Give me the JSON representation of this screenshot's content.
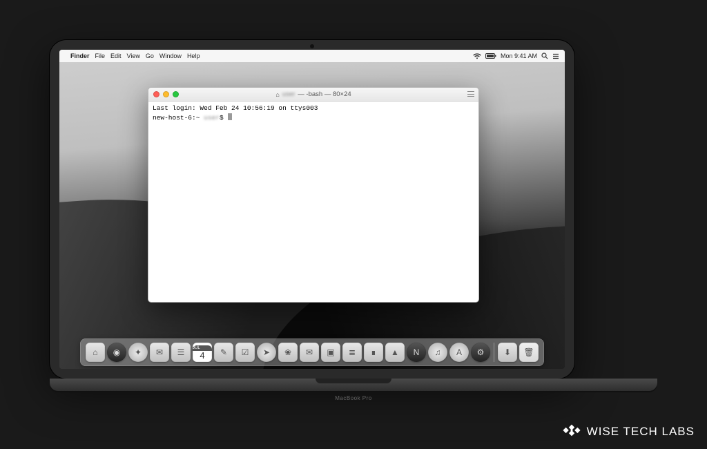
{
  "hardware": {
    "model_label": "MacBook Pro"
  },
  "menubar": {
    "app_name": "Finder",
    "items": [
      "File",
      "Edit",
      "View",
      "Go",
      "Window",
      "Help"
    ],
    "clock": "Mon 9:41 AM"
  },
  "terminal": {
    "title_user_blurred": "user",
    "title_suffix": " — -bash — 80×24",
    "line1": "Last login: Wed Feb 24 10:56:19 on ttys003",
    "prompt_host": "new-host-6:~ ",
    "prompt_user_blurred": "user",
    "prompt_suffix": "$ "
  },
  "dock": {
    "cal_month": "JUL",
    "cal_day": "4",
    "items": [
      {
        "name": "finder",
        "glyph": "⌂",
        "round": false
      },
      {
        "name": "launchpad",
        "glyph": "◉",
        "round": true,
        "dark": true
      },
      {
        "name": "safari",
        "glyph": "✦",
        "round": true
      },
      {
        "name": "mail",
        "glyph": "✉",
        "round": false
      },
      {
        "name": "contacts",
        "glyph": "☰",
        "round": false
      },
      {
        "name": "calendar",
        "glyph": "",
        "round": false,
        "cal": true
      },
      {
        "name": "notes",
        "glyph": "✎",
        "round": false
      },
      {
        "name": "reminders",
        "glyph": "☑",
        "round": false
      },
      {
        "name": "maps",
        "glyph": "➤",
        "round": true
      },
      {
        "name": "photos",
        "glyph": "❀",
        "round": false
      },
      {
        "name": "messages",
        "glyph": "✉",
        "round": false
      },
      {
        "name": "facetime",
        "glyph": "▣",
        "round": false
      },
      {
        "name": "pages",
        "glyph": "≣",
        "round": false
      },
      {
        "name": "numbers",
        "glyph": "∎",
        "round": false
      },
      {
        "name": "keynote",
        "glyph": "▲",
        "round": false
      },
      {
        "name": "news",
        "glyph": "N",
        "round": true,
        "dark": true
      },
      {
        "name": "itunes",
        "glyph": "♫",
        "round": true
      },
      {
        "name": "appstore",
        "glyph": "A",
        "round": true
      },
      {
        "name": "preferences",
        "glyph": "⚙",
        "round": true,
        "dark": true
      }
    ],
    "after_sep": [
      {
        "name": "downloads",
        "glyph": "⬇"
      },
      {
        "name": "trash",
        "glyph": "🗑"
      }
    ]
  },
  "watermark": {
    "text": "WISE TECH LABS"
  }
}
